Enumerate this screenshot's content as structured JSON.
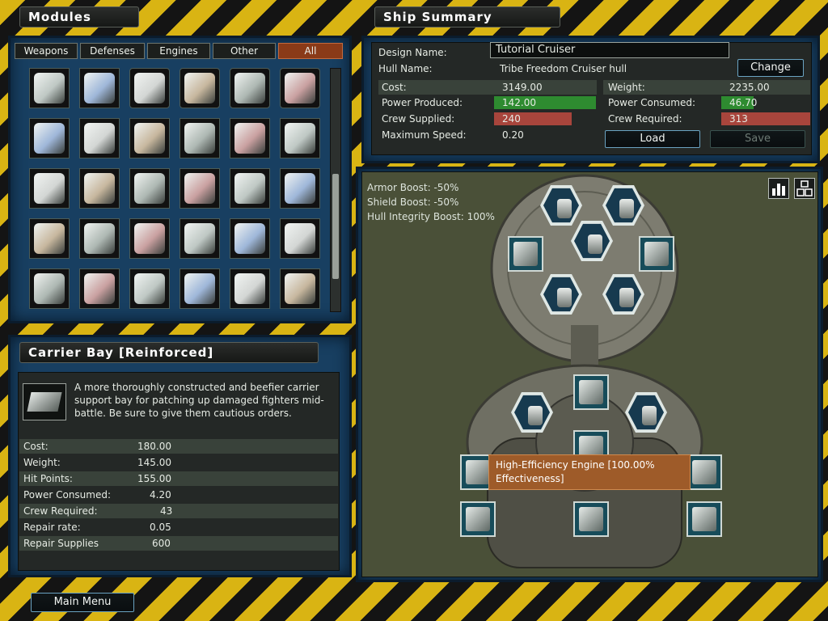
{
  "modules": {
    "title": "Modules",
    "tabs": [
      "Weapons",
      "Defenses",
      "Engines",
      "Other",
      "All"
    ],
    "active_tab": "All"
  },
  "summary": {
    "title": "Ship Summary",
    "design_name_label": "Design Name:",
    "design_name_value": "Tutorial Cruiser",
    "hull_name_label": "Hull Name:",
    "hull_name_value": "Tribe Freedom Cruiser hull",
    "change_label": "Change",
    "left": [
      {
        "label": "Cost:",
        "value": "3149.00"
      },
      {
        "label": "Power Produced:",
        "value": "142.00"
      },
      {
        "label": "Crew Supplied:",
        "value": "240"
      },
      {
        "label": "Maximum Speed:",
        "value": "0.20"
      }
    ],
    "right": [
      {
        "label": "Weight:",
        "value": "2235.00"
      },
      {
        "label": "Power Consumed:",
        "value": "46.70"
      },
      {
        "label": "Crew Required:",
        "value": "313"
      }
    ],
    "load_label": "Load",
    "save_label": "Save"
  },
  "details": {
    "title": "Carrier Bay [Reinforced]",
    "description": "A more thoroughly constructed and beefier carrier support bay for patching up damaged fighters mid-battle. Be sure to give them cautious orders.",
    "stats": [
      {
        "label": "Cost:",
        "value": "180.00"
      },
      {
        "label": "Weight:",
        "value": "145.00"
      },
      {
        "label": "Hit Points:",
        "value": "155.00"
      },
      {
        "label": "Power Consumed:",
        "value": "4.20"
      },
      {
        "label": "Crew Required:",
        "value": "43"
      },
      {
        "label": "Repair rate:",
        "value": "0.05"
      },
      {
        "label": "Repair Supplies",
        "value": "600"
      }
    ]
  },
  "ship": {
    "boosts": [
      "Armor Boost: -50%",
      "Shield Boost: -50%",
      "Hull Integrity Boost: 100%"
    ],
    "tooltip": "High-Efficiency Engine [100.00% Effectiveness]"
  },
  "footer": {
    "main_menu_label": "Main Menu"
  },
  "colors": {
    "green": "#2e8b30",
    "red": "#a8453c",
    "accent": "#8a3a18"
  }
}
